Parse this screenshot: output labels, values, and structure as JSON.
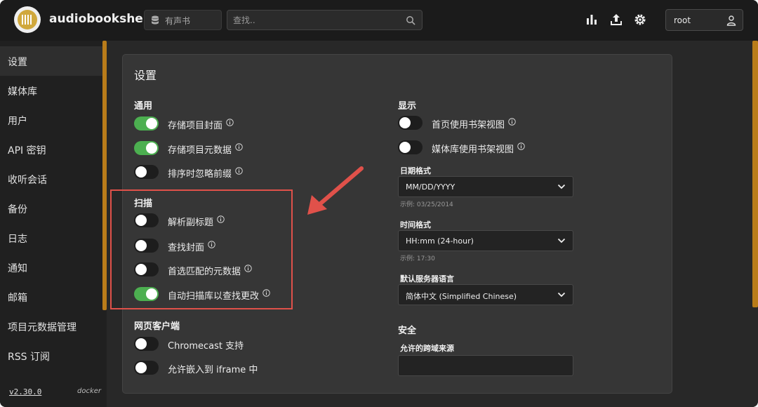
{
  "topbar": {
    "app_name": "audiobookshelf",
    "library_name": "有声书",
    "search_placeholder": "查找..",
    "user_name": "root"
  },
  "sidebar": {
    "items": [
      {
        "label": "设置",
        "active": true
      },
      {
        "label": "媒体库"
      },
      {
        "label": "用户"
      },
      {
        "label": "API 密钥"
      },
      {
        "label": "收听会话"
      },
      {
        "label": "备份"
      },
      {
        "label": "日志"
      },
      {
        "label": "通知"
      },
      {
        "label": "邮箱"
      },
      {
        "label": "项目元数据管理"
      },
      {
        "label": "RSS 订阅"
      }
    ],
    "version": "v2.30.0",
    "build": "docker"
  },
  "settings": {
    "title": "设置",
    "general": {
      "title": "通用",
      "items": [
        {
          "label": "存储项目封面",
          "on": true
        },
        {
          "label": "存储项目元数据",
          "on": true
        },
        {
          "label": "排序时忽略前缀",
          "on": false
        }
      ]
    },
    "scanner": {
      "title": "扫描",
      "items": [
        {
          "label": "解析副标题",
          "on": false
        },
        {
          "label": "查找封面",
          "on": false
        },
        {
          "label": "首选匹配的元数据",
          "on": false
        },
        {
          "label": "自动扫描库以查找更改",
          "on": true
        }
      ]
    },
    "web_client": {
      "title": "网页客户端",
      "items": [
        {
          "label": "Chromecast 支持",
          "on": false
        },
        {
          "label": "允许嵌入到 iframe 中",
          "on": false
        }
      ]
    },
    "display": {
      "title": "显示",
      "items": [
        {
          "label": "首页使用书架视图",
          "on": false
        },
        {
          "label": "媒体库使用书架视图",
          "on": false
        }
      ],
      "date_format": {
        "label": "日期格式",
        "value": "MM/DD/YYYY",
        "example": "示例: 03/25/2014"
      },
      "time_format": {
        "label": "时间格式",
        "value": "HH:mm (24-hour)",
        "example": "示例: 17:30"
      },
      "language": {
        "label": "默认服务器语言",
        "value": "简体中文 (Simplified Chinese)"
      }
    },
    "security": {
      "title": "安全",
      "cors_label": "允许的跨域来源",
      "cors_value": ""
    }
  },
  "colors": {
    "accent": "#b97c1a",
    "toggle_on": "#4caf50",
    "annotation": "#e0514a"
  }
}
